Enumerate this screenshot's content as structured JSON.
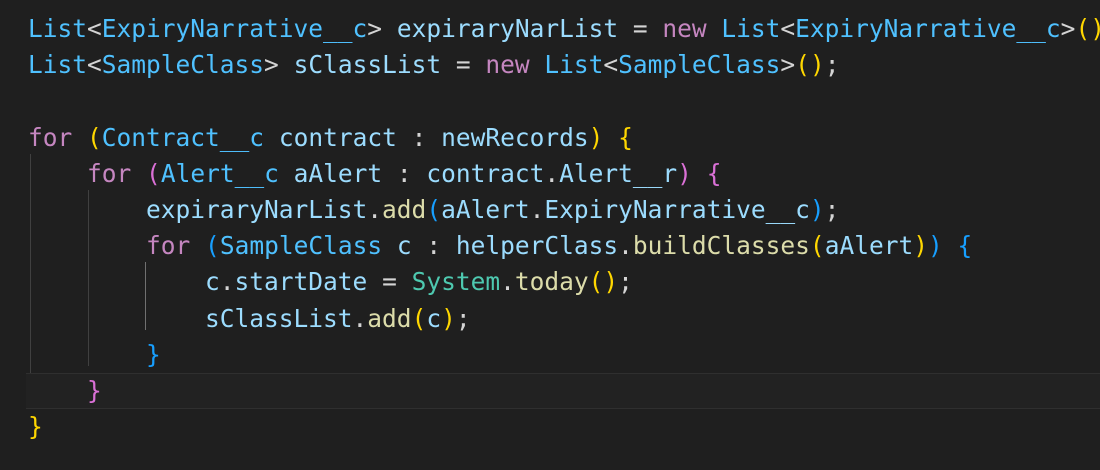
{
  "editor": {
    "lines": [
      [
        {
          "text": "List",
          "cls": "ty"
        },
        {
          "text": "<",
          "cls": "p"
        },
        {
          "text": "ExpiryNarrative__c",
          "cls": "ty"
        },
        {
          "text": "> ",
          "cls": "p"
        },
        {
          "text": "expiraryNarList",
          "cls": "v"
        },
        {
          "text": " = ",
          "cls": "p"
        },
        {
          "text": "new",
          "cls": "k"
        },
        {
          "text": " ",
          "cls": "p"
        },
        {
          "text": "List",
          "cls": "ty"
        },
        {
          "text": "<",
          "cls": "p"
        },
        {
          "text": "ExpiryNarrative__c",
          "cls": "ty"
        },
        {
          "text": ">",
          "cls": "p"
        },
        {
          "text": "()",
          "cls": "b1"
        },
        {
          "text": ";",
          "cls": "p"
        }
      ],
      [
        {
          "text": "List",
          "cls": "ty"
        },
        {
          "text": "<",
          "cls": "p"
        },
        {
          "text": "SampleClass",
          "cls": "ty"
        },
        {
          "text": "> ",
          "cls": "p"
        },
        {
          "text": "sClassList",
          "cls": "v"
        },
        {
          "text": " = ",
          "cls": "p"
        },
        {
          "text": "new",
          "cls": "k"
        },
        {
          "text": " ",
          "cls": "p"
        },
        {
          "text": "List",
          "cls": "ty"
        },
        {
          "text": "<",
          "cls": "p"
        },
        {
          "text": "SampleClass",
          "cls": "ty"
        },
        {
          "text": ">",
          "cls": "p"
        },
        {
          "text": "()",
          "cls": "b1"
        },
        {
          "text": ";",
          "cls": "p"
        }
      ],
      [],
      [
        {
          "text": "for",
          "cls": "k"
        },
        {
          "text": " ",
          "cls": "p"
        },
        {
          "text": "(",
          "cls": "b1"
        },
        {
          "text": "Contract__c",
          "cls": "ty"
        },
        {
          "text": " ",
          "cls": "p"
        },
        {
          "text": "contract",
          "cls": "v"
        },
        {
          "text": " : ",
          "cls": "p"
        },
        {
          "text": "newRecords",
          "cls": "v"
        },
        {
          "text": ")",
          "cls": "b1"
        },
        {
          "text": " ",
          "cls": "p"
        },
        {
          "text": "{",
          "cls": "b1"
        }
      ],
      [
        {
          "text": "    ",
          "cls": "p"
        },
        {
          "text": "for",
          "cls": "k"
        },
        {
          "text": " ",
          "cls": "p"
        },
        {
          "text": "(",
          "cls": "b2"
        },
        {
          "text": "Alert__c",
          "cls": "ty"
        },
        {
          "text": " ",
          "cls": "p"
        },
        {
          "text": "aAlert",
          "cls": "v"
        },
        {
          "text": " : ",
          "cls": "p"
        },
        {
          "text": "contract",
          "cls": "v"
        },
        {
          "text": ".",
          "cls": "p"
        },
        {
          "text": "Alert__r",
          "cls": "v"
        },
        {
          "text": ")",
          "cls": "b2"
        },
        {
          "text": " ",
          "cls": "p"
        },
        {
          "text": "{",
          "cls": "b2"
        }
      ],
      [
        {
          "text": "        ",
          "cls": "p"
        },
        {
          "text": "expiraryNarList",
          "cls": "v"
        },
        {
          "text": ".",
          "cls": "p"
        },
        {
          "text": "add",
          "cls": "f"
        },
        {
          "text": "(",
          "cls": "b3"
        },
        {
          "text": "aAlert",
          "cls": "v"
        },
        {
          "text": ".",
          "cls": "p"
        },
        {
          "text": "ExpiryNarrative__c",
          "cls": "v"
        },
        {
          "text": ")",
          "cls": "b3"
        },
        {
          "text": ";",
          "cls": "p"
        }
      ],
      [
        {
          "text": "        ",
          "cls": "p"
        },
        {
          "text": "for",
          "cls": "k"
        },
        {
          "text": " ",
          "cls": "p"
        },
        {
          "text": "(",
          "cls": "b3"
        },
        {
          "text": "SampleClass",
          "cls": "ty"
        },
        {
          "text": " ",
          "cls": "p"
        },
        {
          "text": "c",
          "cls": "v"
        },
        {
          "text": " : ",
          "cls": "p"
        },
        {
          "text": "helperClass",
          "cls": "v"
        },
        {
          "text": ".",
          "cls": "p"
        },
        {
          "text": "buildClasses",
          "cls": "f"
        },
        {
          "text": "(",
          "cls": "b1"
        },
        {
          "text": "aAlert",
          "cls": "v"
        },
        {
          "text": ")",
          "cls": "b1"
        },
        {
          "text": ")",
          "cls": "b3"
        },
        {
          "text": " ",
          "cls": "p"
        },
        {
          "text": "{",
          "cls": "b3"
        }
      ],
      [
        {
          "text": "            ",
          "cls": "p"
        },
        {
          "text": "c",
          "cls": "v"
        },
        {
          "text": ".",
          "cls": "p"
        },
        {
          "text": "startDate",
          "cls": "v"
        },
        {
          "text": " = ",
          "cls": "p"
        },
        {
          "text": "System",
          "cls": "t"
        },
        {
          "text": ".",
          "cls": "p"
        },
        {
          "text": "today",
          "cls": "f"
        },
        {
          "text": "()",
          "cls": "b1"
        },
        {
          "text": ";",
          "cls": "p"
        }
      ],
      [
        {
          "text": "            ",
          "cls": "p"
        },
        {
          "text": "sClassList",
          "cls": "v"
        },
        {
          "text": ".",
          "cls": "p"
        },
        {
          "text": "add",
          "cls": "f"
        },
        {
          "text": "(",
          "cls": "b1"
        },
        {
          "text": "c",
          "cls": "v"
        },
        {
          "text": ")",
          "cls": "b1"
        },
        {
          "text": ";",
          "cls": "p"
        }
      ],
      [
        {
          "text": "        ",
          "cls": "p"
        },
        {
          "text": "}",
          "cls": "b3"
        }
      ],
      [
        {
          "text": "    ",
          "cls": "p"
        },
        {
          "text": "}",
          "cls": "b2"
        }
      ],
      [
        {
          "text": "}",
          "cls": "b1"
        }
      ]
    ],
    "current_line": 10
  },
  "colors": {
    "background": "#1f1f1f",
    "keyword": "#c586c0",
    "type": "#4fc1ff",
    "variable": "#9cdcfe",
    "function": "#dcdcaa",
    "bracket_level_1": "#ffd700",
    "bracket_level_2": "#da70d6",
    "bracket_level_3": "#179fff"
  }
}
